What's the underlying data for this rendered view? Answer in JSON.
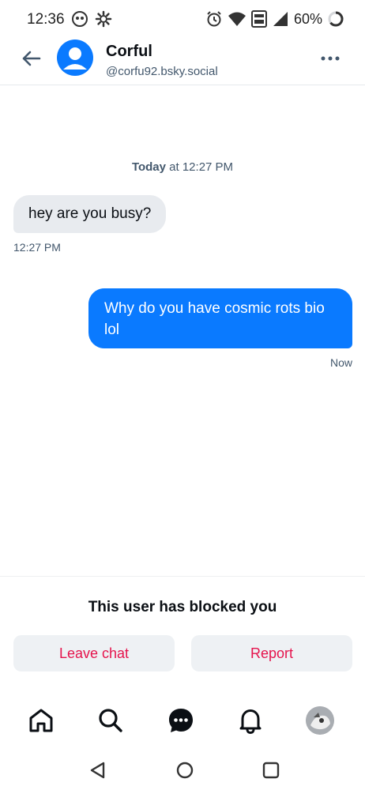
{
  "status_bar": {
    "time": "12:36",
    "battery": "60%",
    "icons": [
      "alarm-icon",
      "wifi-icon",
      "volte-icon",
      "signal-icon",
      "battery-icon"
    ]
  },
  "header": {
    "title": "Corful",
    "handle": "@corfu92.bsky.social"
  },
  "conversation": {
    "date_bold": "Today",
    "date_rest": " at 12:27 PM",
    "messages": [
      {
        "direction": "incoming",
        "text": "hey are you busy?",
        "time": "12:27 PM"
      },
      {
        "direction": "outgoing",
        "text": "Why do you have cosmic rots bio lol",
        "time": "Now"
      }
    ]
  },
  "blocked": {
    "message": "This user has blocked you",
    "leave_label": "Leave chat",
    "report_label": "Report"
  },
  "colors": {
    "accent": "#0a7aff",
    "danger": "#e5134c",
    "bubble_incoming": "#e8ebef",
    "muted_text": "#42576c"
  }
}
